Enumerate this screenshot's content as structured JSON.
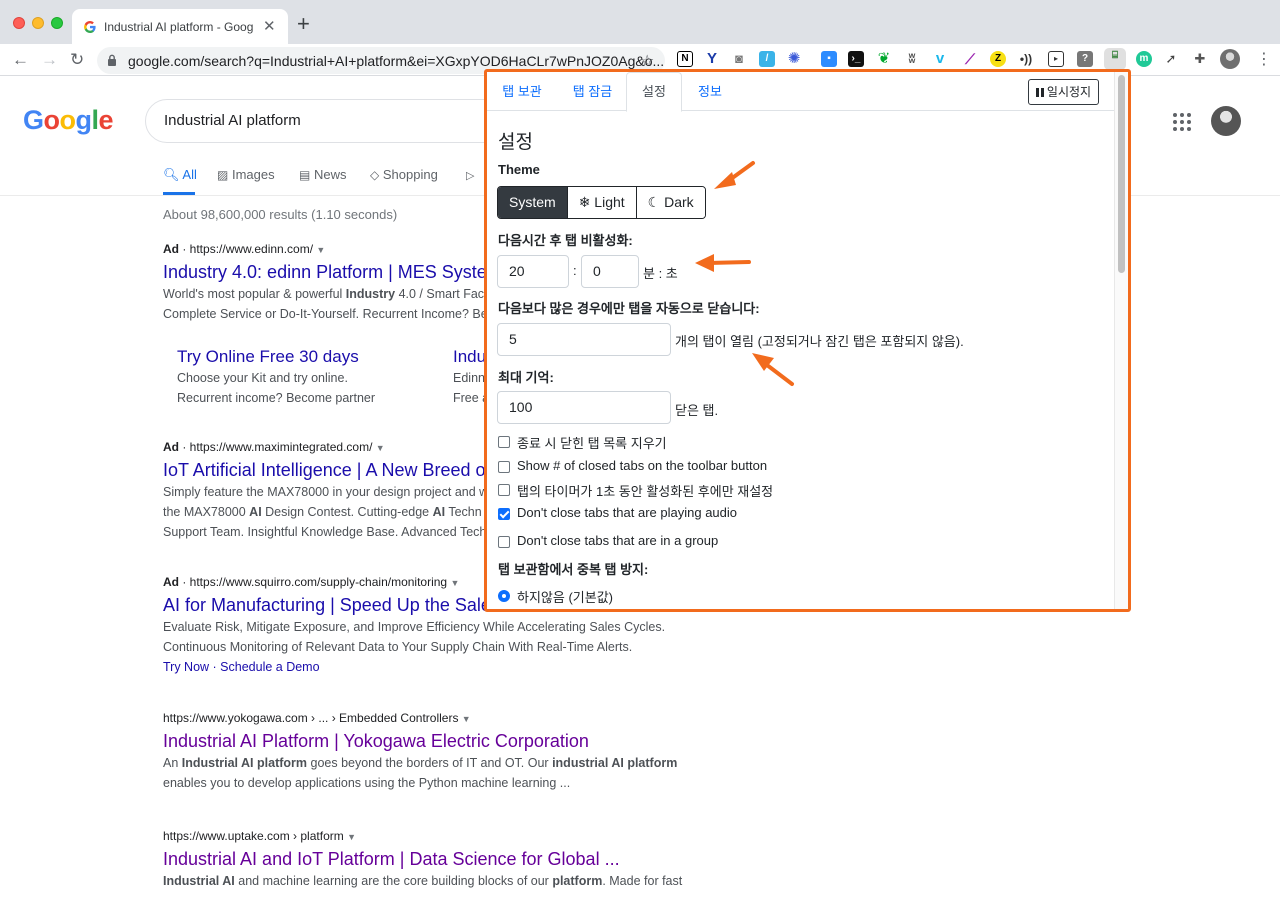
{
  "browser": {
    "tab_title": "Industrial AI platform - Google Search",
    "new_tab": "+",
    "url": "google.com/search?q=Industrial+AI+platform&ei=XGxpYOD6HaCLr7wPnJOZ0Ag&o...",
    "extensions": [
      "notion-icon",
      "vivaldi-icon",
      "camera-icon",
      "feather-icon",
      "snowflake-icon",
      "zoom-icon",
      "terminal-icon",
      "evernote-icon",
      "bird-icon",
      "vimeo-icon",
      "quill-icon",
      "zotero-icon",
      "audio-icon",
      "screen-icon",
      "help-icon",
      "tab-manager-icon",
      "m-icon",
      "rocket-icon",
      "puzzle-icon"
    ]
  },
  "google": {
    "logo": "Google",
    "query": "Industrial AI platform",
    "tabs": [
      {
        "label": "All",
        "icon": "search-icon"
      },
      {
        "label": "Images",
        "icon": "image-icon"
      },
      {
        "label": "News",
        "icon": "news-icon"
      },
      {
        "label": "Shopping",
        "icon": "tag-icon"
      }
    ],
    "stats": "About 98,600,000 results (1.10 seconds)",
    "results": [
      {
        "ad": "Ad",
        "url": "https://www.edinn.com/",
        "title": "Industry 4.0: edinn Platform | MES Syste",
        "desc1": "World's most popular & powerful ",
        "desc1_bold": "Industry",
        "desc1_tail": " 4.0 / Smart Fac",
        "desc2": "Complete Service or Do-It-Yourself. Recurrent Income? Be",
        "sitelinks": [
          {
            "title": "Try Online Free 30 days",
            "desc1": "Choose your Kit and try online.",
            "desc2": "Recurrent income? Become partner"
          },
          {
            "title": "Indu",
            "desc1": "Edinn",
            "desc2": "Free a"
          }
        ]
      },
      {
        "ad": "Ad",
        "url": "https://www.maximintegrated.com/",
        "title": "IoT Artificial Intelligence | A New Breed o",
        "desc1": "Simply feature the MAX78000 in your design project and w",
        "desc2_pre": "the MAX78000 ",
        "desc2_bold": "AI",
        "desc2_mid": " Design Contest. Cutting-edge ",
        "desc2_bold2": "AI",
        "desc2_tail": " Techn",
        "desc3": "Support Team. Insightful Knowledge Base. Advanced Tech"
      },
      {
        "ad": "Ad",
        "url": "https://www.squirro.com/supply-chain/monitoring",
        "title": "AI for Manufacturing | Speed Up the Sale",
        "desc1": "Evaluate Risk, Mitigate Exposure, and Improve Efficiency While Accelerating Sales Cycles.",
        "desc2": "Continuous Monitoring of Relevant Data to Your Supply Chain With Real-Time Alerts.",
        "links": "Try Now · Schedule a Demo"
      },
      {
        "url": "https://www.yokogawa.com › ... › Embedded Controllers",
        "title": "Industrial AI Platform | Yokogawa Electric Corporation",
        "desc1_pre": "An ",
        "desc1_bold": "Industrial AI platform",
        "desc1_mid": " goes beyond the borders of IT and OT. Our ",
        "desc1_bold2": "industrial AI platform",
        "desc2": "enables you to develop applications using the Python machine learning ..."
      },
      {
        "url": "https://www.uptake.com › platform",
        "title": "Industrial AI and IoT Platform | Data Science for Global ...",
        "desc1_bold": "Industrial AI",
        "desc1_mid": " and machine learning are the core building blocks of our ",
        "desc1_bold2": "platform",
        "desc1_tail": ". Made for fast"
      }
    ]
  },
  "popup": {
    "tabs": [
      "탭 보관",
      "탭 잠금",
      "설정",
      "정보"
    ],
    "pause": "일시정지",
    "heading": "설정",
    "theme_label": "Theme",
    "theme_options": [
      "System",
      "❄ Light",
      "☾ Dark"
    ],
    "inactive_label": "다음시간 후 탭 비활성화:",
    "minutes": "20",
    "seconds": "0",
    "colon": ":",
    "time_unit": "분 : 초",
    "autoclose_label": "다음보다 많은 경우에만 탭을 자동으로 닫습니다:",
    "autoclose_value": "5",
    "autoclose_suffix": "개의 탭이 열림 (고정되거나 잠긴 탭은 포함되지 않음).",
    "memory_label": "최대 기억:",
    "memory_value": "100",
    "memory_suffix": "닫은 탭.",
    "checkboxes": [
      {
        "label": "종료 시 닫힌 탭 목록 지우기",
        "checked": false
      },
      {
        "label": "Show # of closed tabs on the toolbar button",
        "checked": false
      },
      {
        "label": "탭의 타이머가 1초 동안 활성화된 후에만 재설정",
        "checked": false
      },
      {
        "label": "Don't close tabs that are playing audio",
        "checked": true
      },
      {
        "label": "Don't close tabs that are in a group",
        "checked": false
      }
    ],
    "dup_label": "탭 보관함에서 중복 탭 방지:",
    "dup_option": "하지않음 (기본값)"
  },
  "colors": {
    "highlight_border": "#f26b1d",
    "link": "#1a0dab",
    "visited": "#660099",
    "bootstrap_primary": "#0d6efd"
  }
}
